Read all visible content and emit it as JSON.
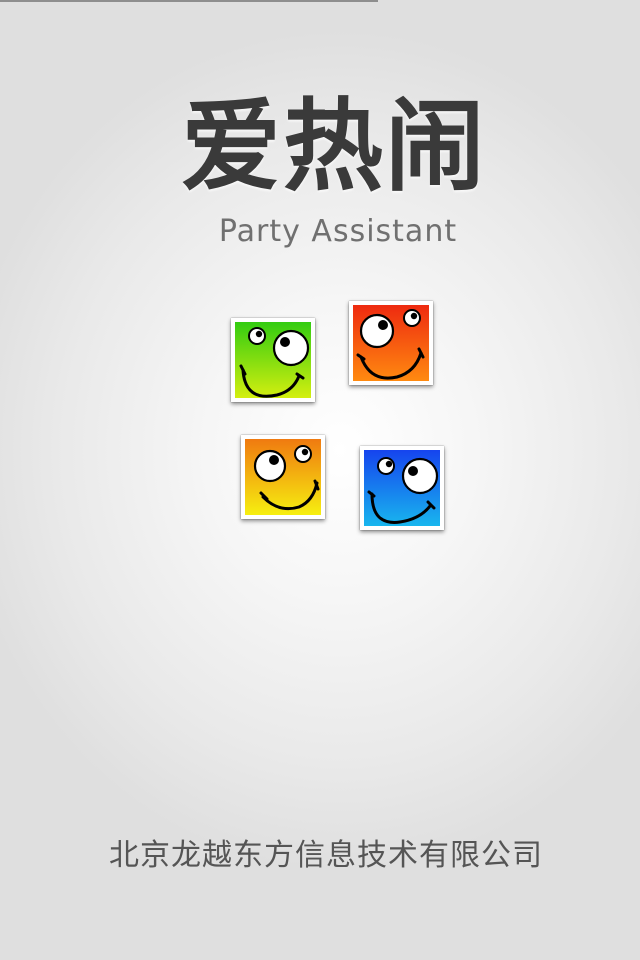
{
  "splash": {
    "title": "爱热闹",
    "subtitle": "Party Assistant",
    "company": "北京龙越东方信息技术有限公司"
  },
  "logo": {
    "faces": [
      {
        "name": "green-smiley-icon",
        "color_top": "#33cc11",
        "color_bottom": "#d4ef10"
      },
      {
        "name": "red-smiley-icon",
        "color_top": "#ee2a10",
        "color_bottom": "#ff8a10"
      },
      {
        "name": "yellow-smiley-icon",
        "color_top": "#f07a10",
        "color_bottom": "#f6ef10"
      },
      {
        "name": "blue-smiley-icon",
        "color_top": "#1644ee",
        "color_bottom": "#18b6ee"
      }
    ]
  },
  "colors": {
    "title": "#3a3a3a",
    "subtitle": "#707070",
    "company": "#555555",
    "background": "#e9e9e9"
  }
}
